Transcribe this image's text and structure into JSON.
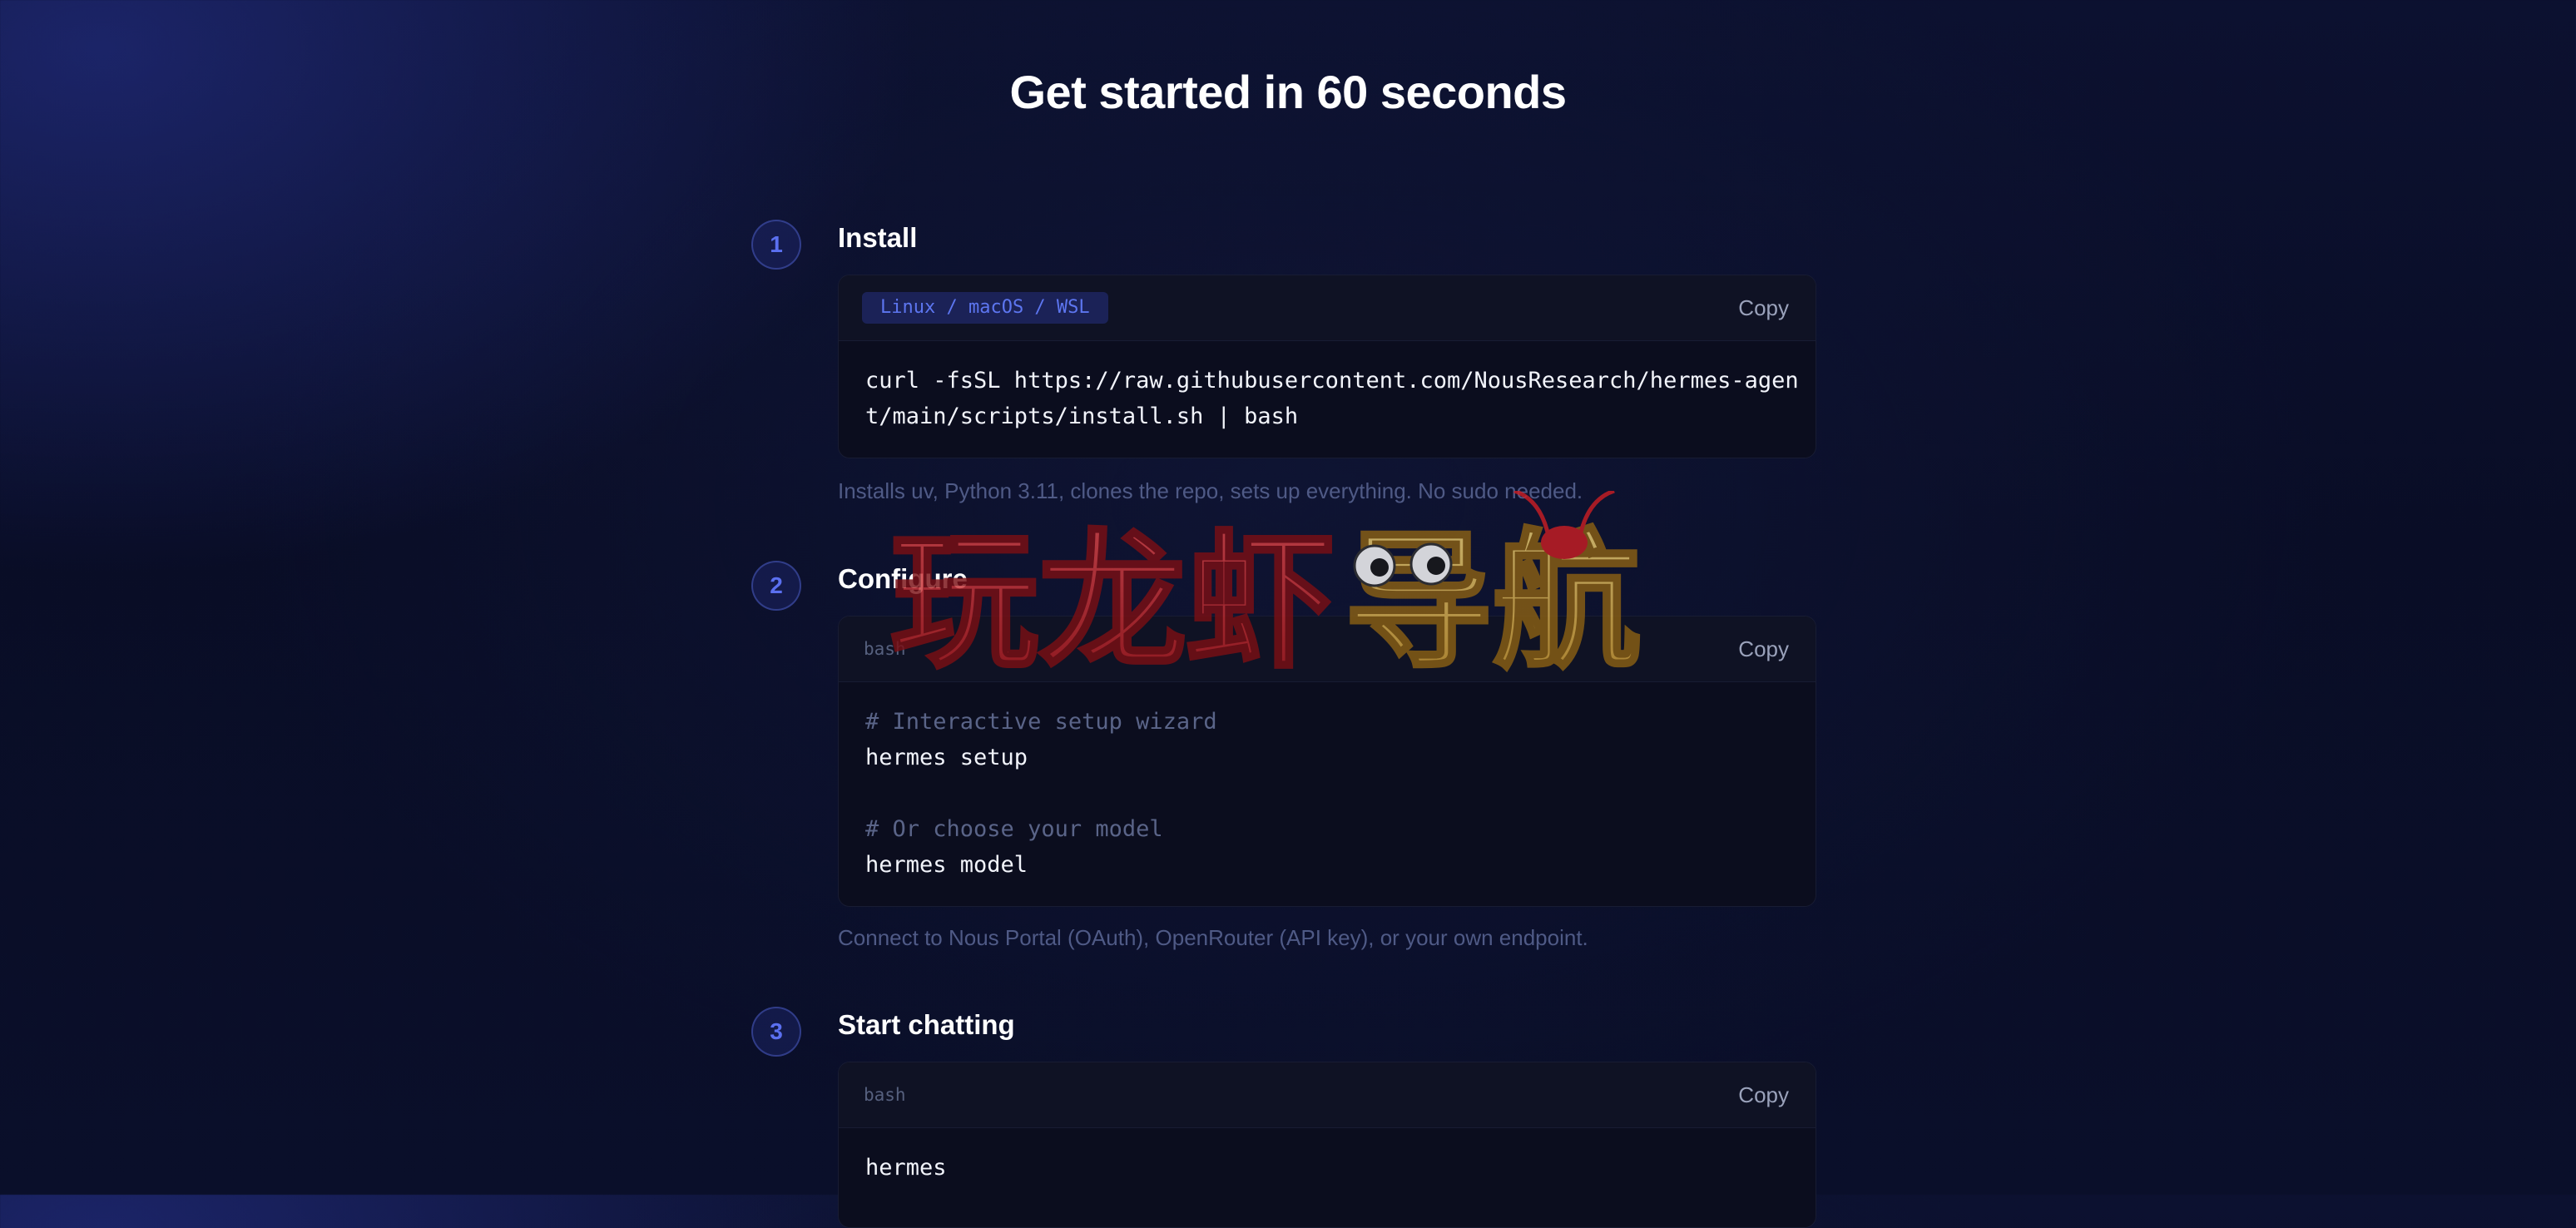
{
  "page": {
    "title": "Get started in 60 seconds"
  },
  "steps": [
    {
      "number": "1",
      "title": "Install",
      "tag": "Linux / macOS / WSL",
      "copy_label": "Copy",
      "code_lines": [
        {
          "text": "curl -fsSL https://raw.githubusercontent.com/NousResearch/hermes-agen",
          "kind": "command"
        },
        {
          "text": "t/main/scripts/install.sh | bash",
          "kind": "command"
        }
      ],
      "caption": "Installs uv, Python 3.11, clones the repo, sets up everything. No sudo needed."
    },
    {
      "number": "2",
      "title": "Configure",
      "tag": "bash",
      "copy_label": "Copy",
      "code_lines": [
        {
          "text": "# Interactive setup wizard",
          "kind": "comment"
        },
        {
          "text": "hermes setup",
          "kind": "command"
        },
        {
          "text": "",
          "kind": "blank"
        },
        {
          "text": "# Or choose your model",
          "kind": "comment"
        },
        {
          "text": "hermes model",
          "kind": "command"
        }
      ],
      "caption": "Connect to Nous Portal (OAuth), OpenRouter (API key), or your own endpoint."
    },
    {
      "number": "3",
      "title": "Start chatting",
      "tag": "bash",
      "copy_label": "Copy",
      "code_lines": [
        {
          "text": "hermes",
          "kind": "command"
        }
      ],
      "caption": ""
    }
  ],
  "watermark": {
    "text": "玩龙虾导航"
  },
  "colors": {
    "background": "#0a0e28",
    "accent": "#5b70f0",
    "code_background": "#0b0d1e",
    "comment": "#5a6488",
    "caption": "#4f5a86"
  }
}
